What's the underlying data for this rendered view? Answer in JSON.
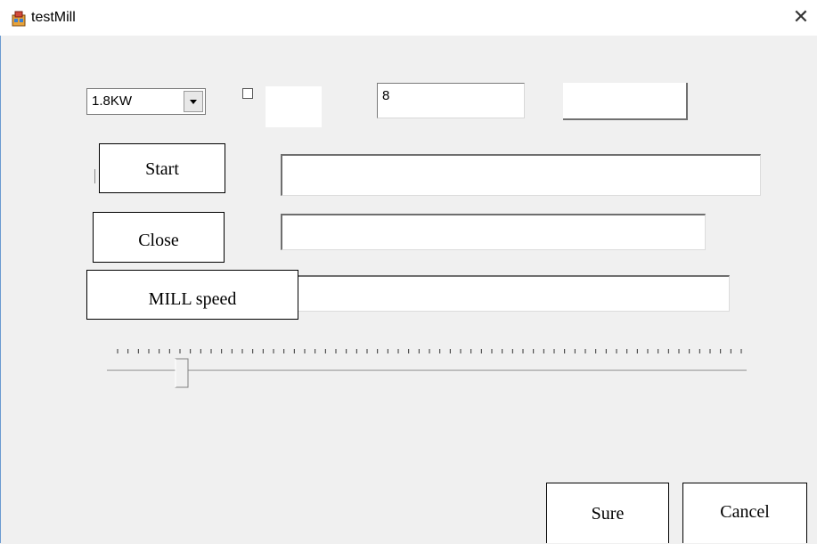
{
  "window": {
    "title": "testMill",
    "app_icon": "app-window-icon",
    "close_icon": "close-icon",
    "close_glyph": "✕"
  },
  "controls": {
    "power_select": {
      "value": "1.8KW"
    },
    "checkbox": {
      "checked": false
    },
    "number_field": {
      "value": "8"
    },
    "start_label": "Start",
    "close_label": "Close",
    "mill_speed_label": "MILL speed",
    "text_field_1": "",
    "text_field_2": "",
    "text_field_3": ""
  },
  "slider": {
    "value_fraction": 0.12
  },
  "footer": {
    "sure_label": "Sure",
    "cancel_label": "Cancel"
  }
}
